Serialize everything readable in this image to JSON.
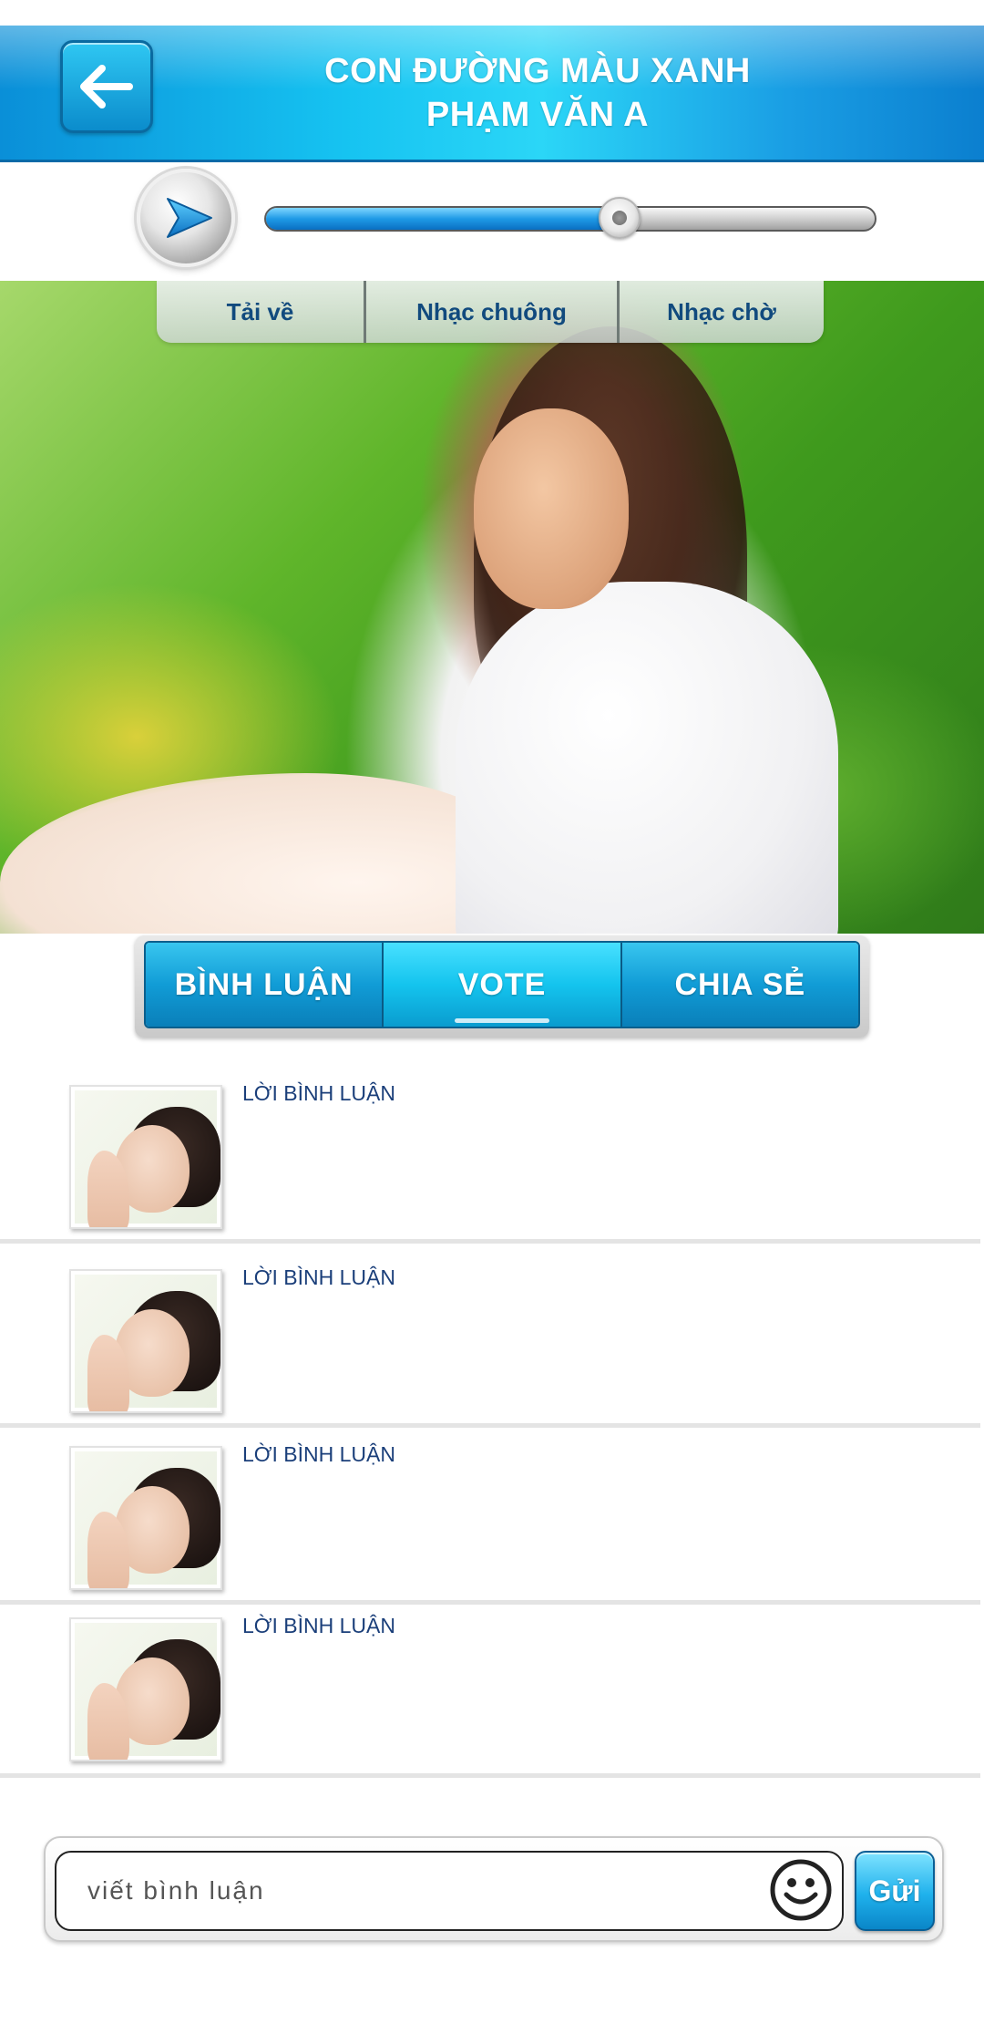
{
  "header": {
    "back_icon": "arrow-left-icon",
    "title_line1": "CON ĐƯỜNG MÀU XANH",
    "title_line2": "PHẠM VĂN A"
  },
  "player": {
    "play_icon": "play-icon",
    "progress_fraction": 0.58
  },
  "photo_tabs": [
    {
      "label": "Tải về"
    },
    {
      "label": "Nhạc chuông"
    },
    {
      "label": "Nhạc chờ"
    }
  ],
  "action_tabs": [
    {
      "label": "BÌNH LUẬN"
    },
    {
      "label": "VOTE"
    },
    {
      "label": "CHIA SẺ"
    }
  ],
  "comments": [
    {
      "text": "LỜI BÌNH LUẬN"
    },
    {
      "text": "LỜI BÌNH LUẬN"
    },
    {
      "text": "LỜI BÌNH LUẬN"
    },
    {
      "text": "LỜI BÌNH LUẬN"
    }
  ],
  "composer": {
    "placeholder": "viết bình luận",
    "emoji_icon": "smiley-icon",
    "send_label": "Gửi"
  },
  "colors": {
    "header_accent": "#16c3f1",
    "text_blue": "#1b3f7a"
  }
}
